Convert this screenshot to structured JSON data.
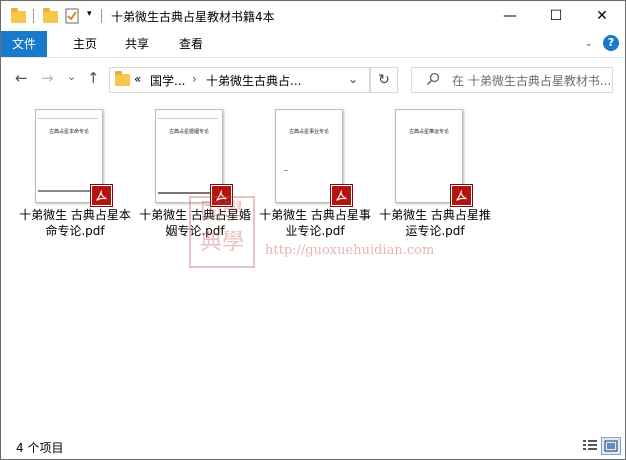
{
  "window": {
    "title": "十弟微生古典占星教材书籍4本",
    "minimize_glyph": "—",
    "maximize_glyph": "☐",
    "close_glyph": "✕"
  },
  "ribbon": {
    "tabs": [
      "文件",
      "主页",
      "共享",
      "查看"
    ],
    "help_glyph": "?"
  },
  "nav": {
    "back_glyph": "←",
    "forward_glyph": "→",
    "recent_glyph": "⌄",
    "up_glyph": "↑",
    "breadcrumb_prefix": "«",
    "breadcrumb": [
      "国学...",
      "十弟微生古典占..."
    ],
    "crumb_sep": "›",
    "dropdown_glyph": "⌄",
    "refresh_glyph": "↻",
    "search_placeholder": "在 十弟微生古典占星教材书..."
  },
  "files": [
    {
      "name": "十弟微生 古典占星本命专论.pdf",
      "thumb_title": "古典占星本命专论"
    },
    {
      "name": "十弟微生 古典占星婚姻专论.pdf",
      "thumb_title": "古典占星婚姻专论"
    },
    {
      "name": "十弟微生 古典占星事业专论.pdf",
      "thumb_title": "古典占星事业专论"
    },
    {
      "name": "十弟微生 古典占星推运专论.pdf",
      "thumb_title": "古典占星推运专论"
    }
  ],
  "watermark": {
    "seal": "国學典學",
    "url": "http://guoxuehuidian.com"
  },
  "status": {
    "item_count": "4 个项目"
  },
  "colors": {
    "file_tab": "#1979ca",
    "pdf_badge": "#b3140f",
    "help_icon": "#1979ca",
    "folder": "#f3c84b"
  }
}
